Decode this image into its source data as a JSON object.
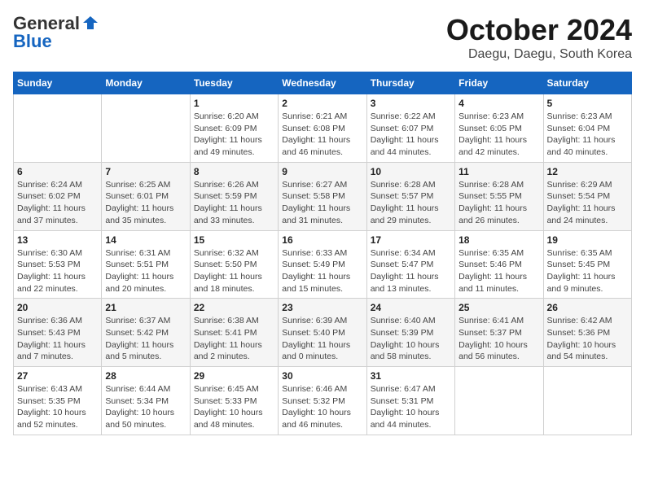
{
  "logo": {
    "general": "General",
    "blue": "Blue"
  },
  "title": "October 2024",
  "location": "Daegu, Daegu, South Korea",
  "days_of_week": [
    "Sunday",
    "Monday",
    "Tuesday",
    "Wednesday",
    "Thursday",
    "Friday",
    "Saturday"
  ],
  "weeks": [
    [
      {
        "day": "",
        "info": ""
      },
      {
        "day": "",
        "info": ""
      },
      {
        "day": "1",
        "info": "Sunrise: 6:20 AM\nSunset: 6:09 PM\nDaylight: 11 hours and 49 minutes."
      },
      {
        "day": "2",
        "info": "Sunrise: 6:21 AM\nSunset: 6:08 PM\nDaylight: 11 hours and 46 minutes."
      },
      {
        "day": "3",
        "info": "Sunrise: 6:22 AM\nSunset: 6:07 PM\nDaylight: 11 hours and 44 minutes."
      },
      {
        "day": "4",
        "info": "Sunrise: 6:23 AM\nSunset: 6:05 PM\nDaylight: 11 hours and 42 minutes."
      },
      {
        "day": "5",
        "info": "Sunrise: 6:23 AM\nSunset: 6:04 PM\nDaylight: 11 hours and 40 minutes."
      }
    ],
    [
      {
        "day": "6",
        "info": "Sunrise: 6:24 AM\nSunset: 6:02 PM\nDaylight: 11 hours and 37 minutes."
      },
      {
        "day": "7",
        "info": "Sunrise: 6:25 AM\nSunset: 6:01 PM\nDaylight: 11 hours and 35 minutes."
      },
      {
        "day": "8",
        "info": "Sunrise: 6:26 AM\nSunset: 5:59 PM\nDaylight: 11 hours and 33 minutes."
      },
      {
        "day": "9",
        "info": "Sunrise: 6:27 AM\nSunset: 5:58 PM\nDaylight: 11 hours and 31 minutes."
      },
      {
        "day": "10",
        "info": "Sunrise: 6:28 AM\nSunset: 5:57 PM\nDaylight: 11 hours and 29 minutes."
      },
      {
        "day": "11",
        "info": "Sunrise: 6:28 AM\nSunset: 5:55 PM\nDaylight: 11 hours and 26 minutes."
      },
      {
        "day": "12",
        "info": "Sunrise: 6:29 AM\nSunset: 5:54 PM\nDaylight: 11 hours and 24 minutes."
      }
    ],
    [
      {
        "day": "13",
        "info": "Sunrise: 6:30 AM\nSunset: 5:53 PM\nDaylight: 11 hours and 22 minutes."
      },
      {
        "day": "14",
        "info": "Sunrise: 6:31 AM\nSunset: 5:51 PM\nDaylight: 11 hours and 20 minutes."
      },
      {
        "day": "15",
        "info": "Sunrise: 6:32 AM\nSunset: 5:50 PM\nDaylight: 11 hours and 18 minutes."
      },
      {
        "day": "16",
        "info": "Sunrise: 6:33 AM\nSunset: 5:49 PM\nDaylight: 11 hours and 15 minutes."
      },
      {
        "day": "17",
        "info": "Sunrise: 6:34 AM\nSunset: 5:47 PM\nDaylight: 11 hours and 13 minutes."
      },
      {
        "day": "18",
        "info": "Sunrise: 6:35 AM\nSunset: 5:46 PM\nDaylight: 11 hours and 11 minutes."
      },
      {
        "day": "19",
        "info": "Sunrise: 6:35 AM\nSunset: 5:45 PM\nDaylight: 11 hours and 9 minutes."
      }
    ],
    [
      {
        "day": "20",
        "info": "Sunrise: 6:36 AM\nSunset: 5:43 PM\nDaylight: 11 hours and 7 minutes."
      },
      {
        "day": "21",
        "info": "Sunrise: 6:37 AM\nSunset: 5:42 PM\nDaylight: 11 hours and 5 minutes."
      },
      {
        "day": "22",
        "info": "Sunrise: 6:38 AM\nSunset: 5:41 PM\nDaylight: 11 hours and 2 minutes."
      },
      {
        "day": "23",
        "info": "Sunrise: 6:39 AM\nSunset: 5:40 PM\nDaylight: 11 hours and 0 minutes."
      },
      {
        "day": "24",
        "info": "Sunrise: 6:40 AM\nSunset: 5:39 PM\nDaylight: 10 hours and 58 minutes."
      },
      {
        "day": "25",
        "info": "Sunrise: 6:41 AM\nSunset: 5:37 PM\nDaylight: 10 hours and 56 minutes."
      },
      {
        "day": "26",
        "info": "Sunrise: 6:42 AM\nSunset: 5:36 PM\nDaylight: 10 hours and 54 minutes."
      }
    ],
    [
      {
        "day": "27",
        "info": "Sunrise: 6:43 AM\nSunset: 5:35 PM\nDaylight: 10 hours and 52 minutes."
      },
      {
        "day": "28",
        "info": "Sunrise: 6:44 AM\nSunset: 5:34 PM\nDaylight: 10 hours and 50 minutes."
      },
      {
        "day": "29",
        "info": "Sunrise: 6:45 AM\nSunset: 5:33 PM\nDaylight: 10 hours and 48 minutes."
      },
      {
        "day": "30",
        "info": "Sunrise: 6:46 AM\nSunset: 5:32 PM\nDaylight: 10 hours and 46 minutes."
      },
      {
        "day": "31",
        "info": "Sunrise: 6:47 AM\nSunset: 5:31 PM\nDaylight: 10 hours and 44 minutes."
      },
      {
        "day": "",
        "info": ""
      },
      {
        "day": "",
        "info": ""
      }
    ]
  ]
}
